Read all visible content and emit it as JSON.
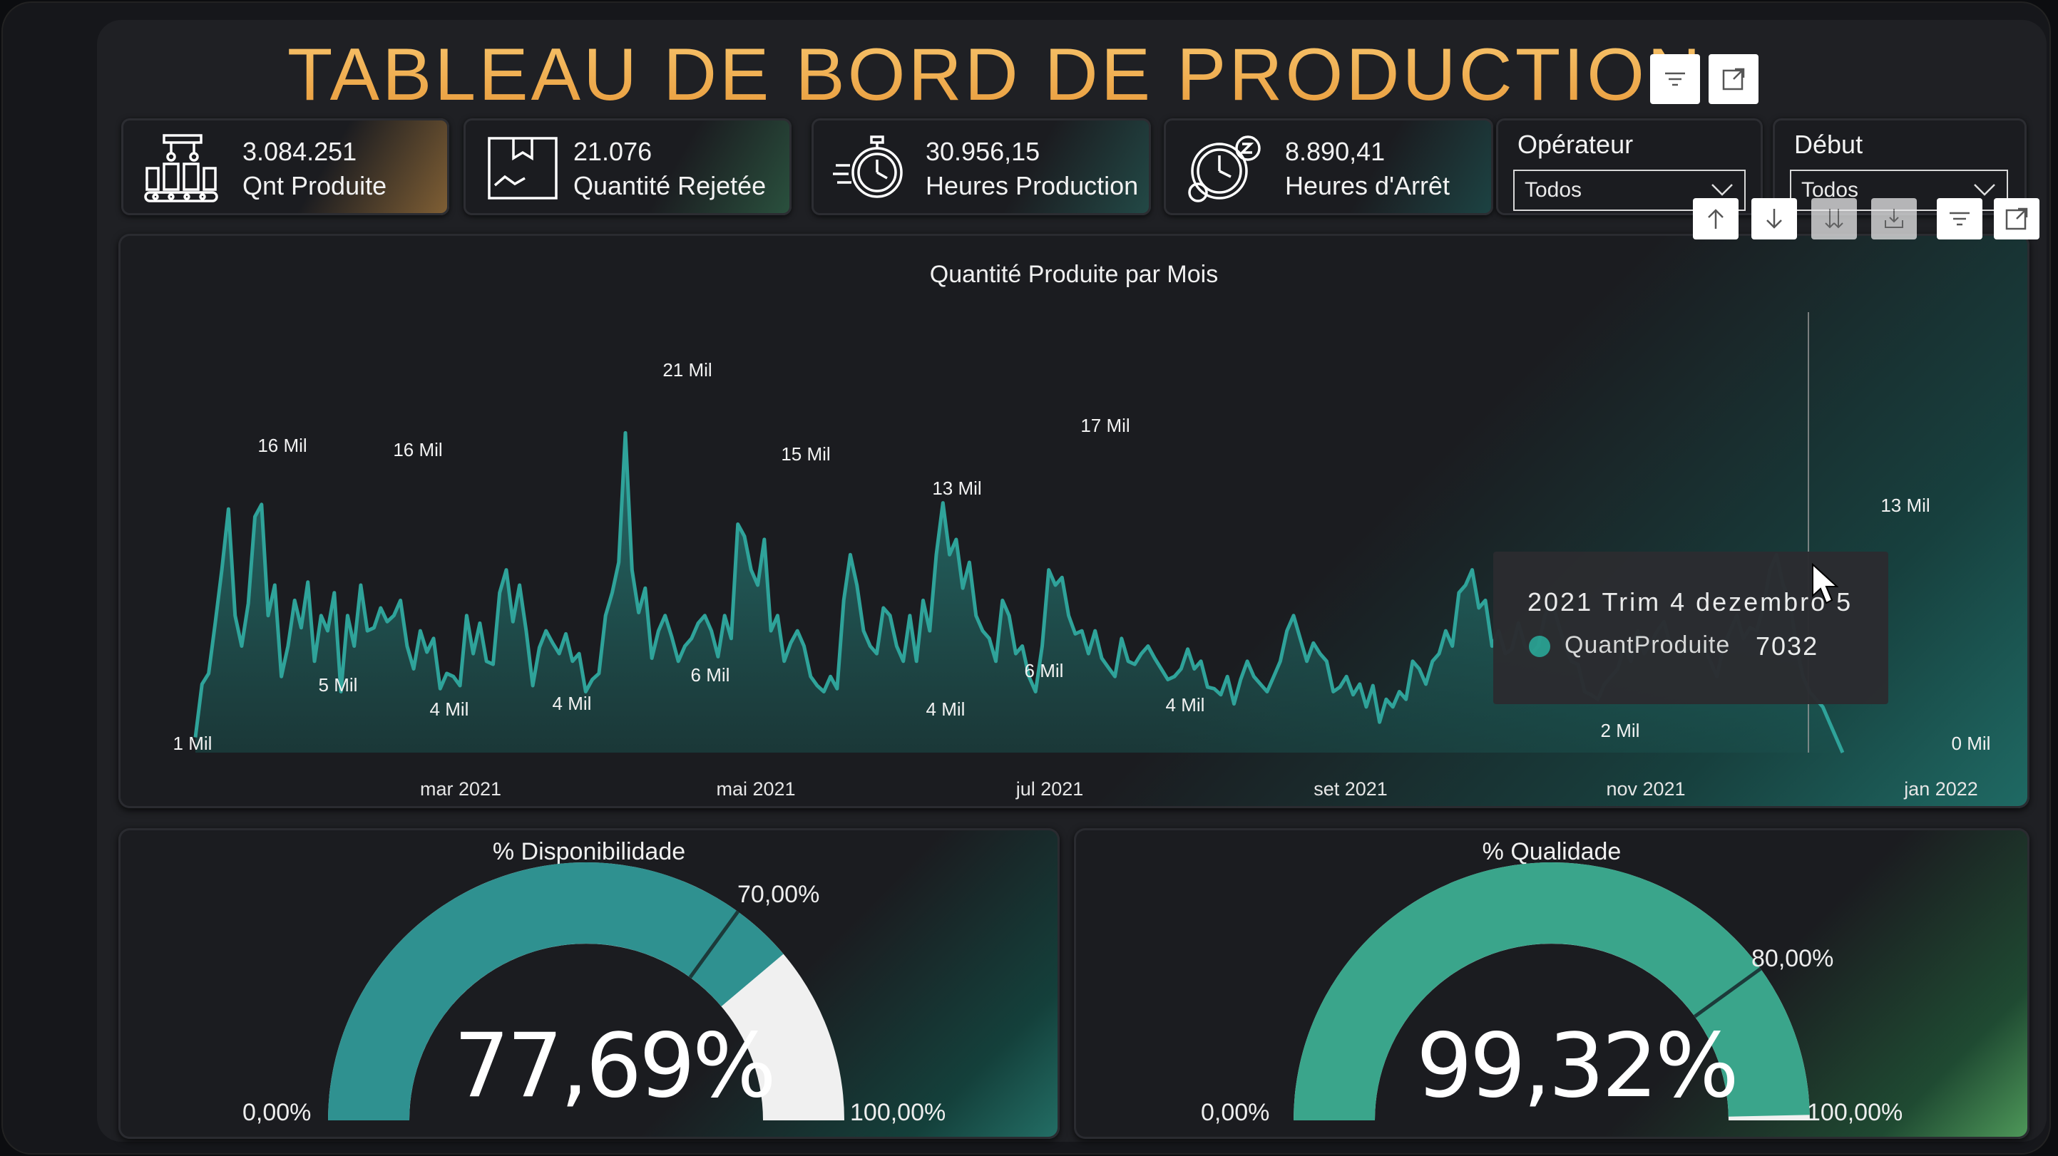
{
  "header": {
    "title": "TABLEAU DE BORD DE PRODUCTION"
  },
  "kpis": [
    {
      "value": "3.084.251",
      "label": "Qnt Produite",
      "icon": "factory-robot-icon",
      "accent": "#e8a449"
    },
    {
      "value": "21.076",
      "label": "Quantité Rejetée",
      "icon": "box-icon",
      "accent": "#3a8a5e"
    },
    {
      "value": "30.956,15",
      "label": "Heures Production",
      "icon": "stopwatch-icon",
      "accent": "#2a7a70"
    },
    {
      "value": "8.890,41",
      "label": "Heures d'Arrêt",
      "icon": "clock-sleep-icon",
      "accent": "#1e6d69"
    }
  ],
  "slicers": [
    {
      "title": "Opérateur",
      "selected": "Todos"
    },
    {
      "title": "Début",
      "selected": "Todos"
    }
  ],
  "line_panel": {
    "title": "Quantité Produite par Mois",
    "x_ticks": [
      "mar 2021",
      "mai 2021",
      "jul 2021",
      "set 2021",
      "nov 2021",
      "jan 2022"
    ]
  },
  "tooltip": {
    "title": "2021 Trim 4 dezembro 5",
    "series": "QuantProduite",
    "value": "7032"
  },
  "gauges": [
    {
      "title": "% Disponibilidade",
      "value_text": "77,69%",
      "value": 77.69,
      "target_text": "70,00%",
      "target": 70,
      "min_text": "0,00%",
      "max_text": "100,00%",
      "fill_color": "#2f9190",
      "track_color": "#f0f0f0"
    },
    {
      "title": "% Qualidade",
      "value_text": "99,32%",
      "value": 99.32,
      "target_text": "80,00%",
      "target": 80,
      "min_text": "0,00%",
      "max_text": "100,00%",
      "fill_color": "#3aa58b",
      "track_color": "#f0f0f0"
    }
  ],
  "chart_data": {
    "type": "area",
    "title": "Quantité Produite par Mois",
    "xlabel": "",
    "ylabel": "",
    "ylim": [
      0,
      22000
    ],
    "x_ticks": [
      "mar 2021",
      "mai 2021",
      "jul 2021",
      "set 2021",
      "nov 2021",
      "jan 2022"
    ],
    "fill_color": "#2a7f7a",
    "line_color": "#2fa39a",
    "grid": false,
    "series": [
      {
        "values": [
          1000,
          4500,
          5200,
          8500,
          12000,
          16000,
          9000,
          7000,
          9800,
          15500,
          16300,
          9000,
          11000,
          5000,
          7000,
          10000,
          8200,
          11200,
          6000,
          9000,
          8000,
          10500,
          4000,
          9000,
          7000,
          11000,
          8000,
          8200,
          9500,
          8600,
          9000,
          10000,
          7000,
          5500,
          8000,
          6600,
          7500,
          4200,
          5200,
          5000,
          4400,
          9000,
          6500,
          8500,
          6000,
          5800,
          10500,
          12000,
          8600,
          11000,
          8000,
          4400,
          6900,
          8000,
          7200,
          6500,
          7800,
          6000,
          6500,
          4000,
          4800,
          5200,
          9000,
          10500,
          12500,
          21000,
          12000,
          9200,
          10800,
          6200,
          8000,
          9000,
          7600,
          6000,
          7000,
          7500,
          8500,
          9000,
          8000,
          6300,
          9000,
          7500,
          15000,
          14200,
          12000,
          11000,
          14000,
          8000,
          9000,
          6000,
          7200,
          8000,
          7000,
          5000,
          4400,
          4000,
          5000,
          4200,
          10000,
          13000,
          11000,
          8000,
          7000,
          6500,
          9500,
          9000,
          7000,
          6000,
          9000,
          6000,
          10000,
          8000,
          13000,
          16400,
          13000,
          14000,
          10800,
          12500,
          9000,
          8000,
          7500,
          6000,
          10000,
          9000,
          6500,
          7000,
          5000,
          4000,
          7000,
          12000,
          11000,
          11500,
          9000,
          7800,
          8000,
          6500,
          8000,
          6200,
          5600,
          5000,
          7500,
          6000,
          5800,
          6500,
          7000,
          6200,
          5500,
          4800,
          5000,
          5500,
          6800,
          5500,
          6000,
          4300,
          4200,
          3800,
          5000,
          3200,
          4800,
          6000,
          5000,
          4500,
          4000,
          5000,
          6000,
          8000,
          9000,
          7500,
          6000,
          7200,
          6500,
          6000,
          4000,
          4300,
          5000,
          3800,
          4500,
          3000,
          4400,
          2000,
          3500,
          3000,
          4000,
          3500,
          6000,
          5500,
          4500,
          6000,
          6500,
          8000,
          7000,
          10500,
          11000,
          12000,
          9500,
          10000,
          7000,
          8000,
          6500,
          6800,
          8500,
          7000,
          6500,
          7000,
          9000,
          10000,
          8500,
          7000,
          6000,
          5800,
          4000,
          3800,
          3500,
          4500,
          5000,
          5500,
          7000,
          6000,
          8000,
          6500,
          7200,
          8000,
          8600,
          7000,
          7300,
          6500,
          6900,
          7032,
          7000,
          6000,
          5000,
          7000,
          8000,
          9000,
          7500,
          8200,
          8000,
          9500,
          12000,
          13000,
          11000,
          10000,
          7000,
          5000,
          4000,
          3500,
          3000,
          2000,
          1000,
          0
        ]
      }
    ],
    "labels": [
      {
        "text": "1 Mil"
      },
      {
        "text": "16 Mil"
      },
      {
        "text": "5 Mil"
      },
      {
        "text": "16 Mil"
      },
      {
        "text": "4 Mil"
      },
      {
        "text": "4 Mil"
      },
      {
        "text": "21 Mil"
      },
      {
        "text": "6 Mil"
      },
      {
        "text": "15 Mil"
      },
      {
        "text": "4 Mil"
      },
      {
        "text": "13 Mil"
      },
      {
        "text": "6 Mil"
      },
      {
        "text": "17 Mil"
      },
      {
        "text": "4 Mil"
      },
      {
        "text": "2 Mil"
      },
      {
        "text": "13 Mil"
      },
      {
        "text": "0 Mil"
      }
    ]
  }
}
